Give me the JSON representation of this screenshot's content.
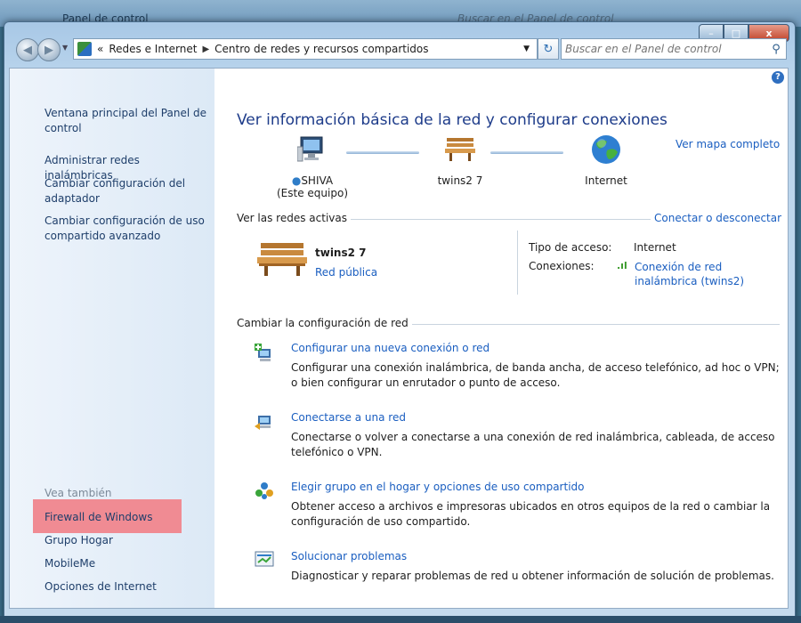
{
  "background_window": {
    "breadcrumb": "Panel de control",
    "search_placeholder": "Buscar en el Panel de control"
  },
  "caption": {
    "minimize": "–",
    "maximize": "□",
    "close": "x"
  },
  "address_bar": {
    "chevron": "«",
    "crumbs": [
      "Redes e Internet",
      "Centro de redes y recursos compartidos"
    ],
    "search_placeholder": "Buscar en el Panel de control"
  },
  "sidebar": {
    "links": [
      "Ventana principal del Panel de control",
      "Administrar redes inalámbricas",
      "Cambiar configuración del adaptador",
      "Cambiar configuración de uso compartido avanzado"
    ],
    "see_also_title": "Vea también",
    "see_also": [
      "Firewall de Windows",
      "Grupo Hogar",
      "MobileMe",
      "Opciones de Internet"
    ]
  },
  "main": {
    "title": "Ver información básica de la red y configurar conexiones",
    "map_link": "Ver mapa completo",
    "nodes": {
      "computer_name": "SHIVA",
      "computer_sub": "(Este equipo)",
      "network_name": "twins2  7",
      "internet": "Internet"
    },
    "active_networks": {
      "title": "Ver las redes activas",
      "connect_link": "Conectar o desconectar",
      "network_name": "twins2  7",
      "network_type": "Red pública",
      "access_label": "Tipo de acceso:",
      "access_value": "Internet",
      "connections_label": "Conexiones:",
      "connections_value": "Conexión de red inalámbrica (twins2)"
    },
    "change_settings": {
      "title": "Cambiar la configuración de red",
      "tasks": [
        {
          "title": "Configurar una nueva conexión o red",
          "desc": "Configurar una conexión inalámbrica, de banda ancha, de acceso telefónico, ad hoc o VPN; o bien configurar un enrutador o punto de acceso."
        },
        {
          "title": "Conectarse a una red",
          "desc": "Conectarse o volver a conectarse a una conexión de red inalámbrica, cableada, de acceso telefónico o VPN."
        },
        {
          "title": "Elegir grupo en el hogar y opciones de uso compartido",
          "desc": "Obtener acceso a archivos e impresoras ubicados en otros equipos de la red o cambiar la configuración de uso compartido."
        },
        {
          "title": "Solucionar problemas",
          "desc": "Diagnosticar y reparar problemas de red u obtener información de solución de problemas."
        }
      ]
    }
  },
  "colors": {
    "link": "#1a5ec0",
    "title": "#1e3c8a",
    "highlight": "#f08b93"
  }
}
